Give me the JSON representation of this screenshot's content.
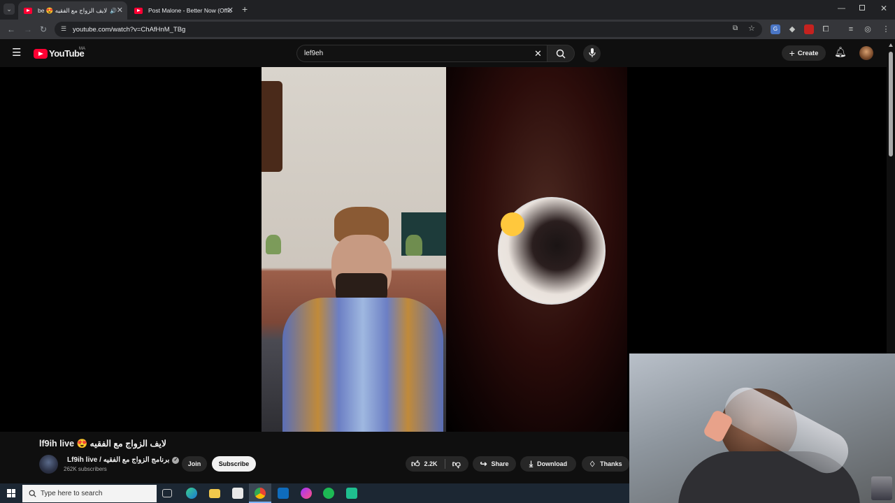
{
  "browser": {
    "tabs": [
      {
        "title": "لايف الزواج مع الفقيه 😍 be",
        "active": true
      },
      {
        "title": "Post Malone - Better Now (Offic",
        "active": false
      }
    ],
    "url": "youtube.com/watch?v=ChAfHnM_TBg"
  },
  "youtube": {
    "logo_text": "YouTube",
    "region": "MA",
    "search_query": "lef9eh",
    "create_label": "Create"
  },
  "video": {
    "title": "lf9ih live 😍 لايف الزواج مع الفقيه",
    "channel_name": "Lf9ih live / برنامج الزواج مع الفقيه",
    "subscribers": "262K subscribers",
    "join_label": "Join",
    "subscribe_label": "Subscribe",
    "like_count": "2.2K",
    "share_label": "Share",
    "download_label": "Download",
    "thanks_label": "Thanks"
  },
  "taskbar": {
    "search_placeholder": "Type here to search"
  },
  "colors": {
    "yt_red": "#ff0033",
    "bg": "#0f0f0f",
    "pill": "#272727"
  }
}
